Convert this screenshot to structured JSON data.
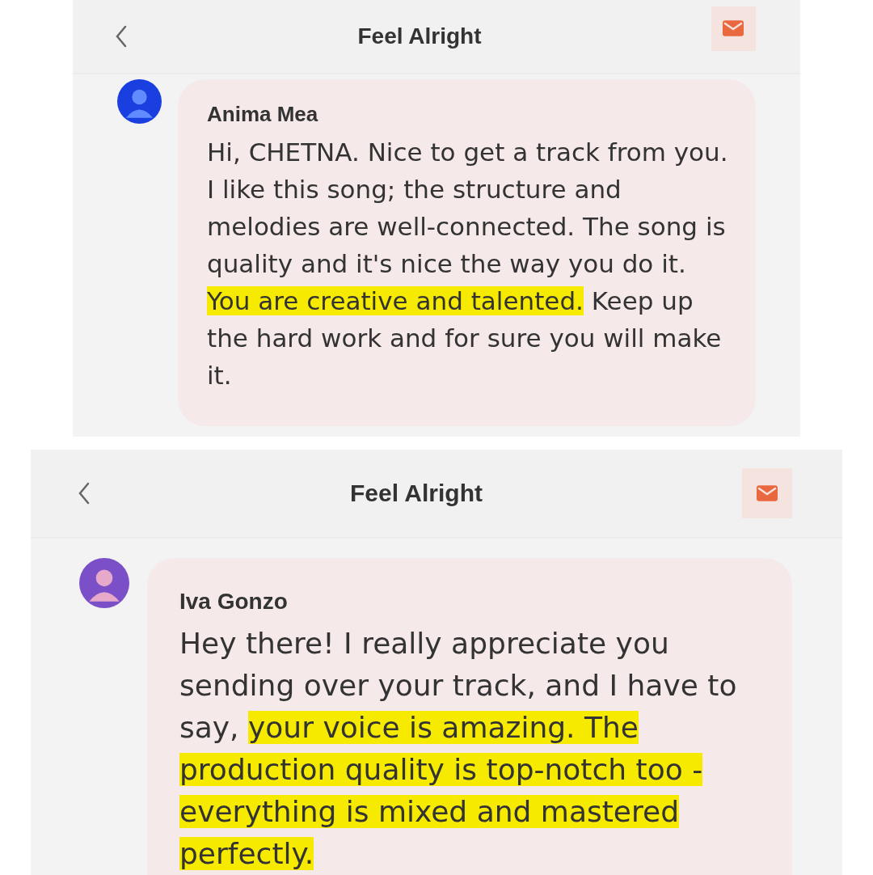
{
  "screens": [
    {
      "title": "Feel Alright",
      "message": {
        "sender": "Anima Mea",
        "segments": [
          {
            "text": "Hi, CHETNA. Nice to get a track from you. I like this song; the structure and melodies are well-connected.  The song is quality and it's nice the way you do it. ",
            "highlighted": false
          },
          {
            "text": "You are creative and talented.",
            "highlighted": true
          },
          {
            "text": " Keep up the hard work and for sure you will make it.",
            "highlighted": false
          }
        ]
      }
    },
    {
      "title": "Feel Alright",
      "message": {
        "sender": "Iva Gonzo",
        "segments": [
          {
            "text": "Hey there! I really appreciate you sending over your track, and I have to say, ",
            "highlighted": false
          },
          {
            "text": "your voice is amazing. The production quality is top-notch too - everything is mixed and mastered perfectly.",
            "highlighted": true
          }
        ]
      }
    }
  ]
}
